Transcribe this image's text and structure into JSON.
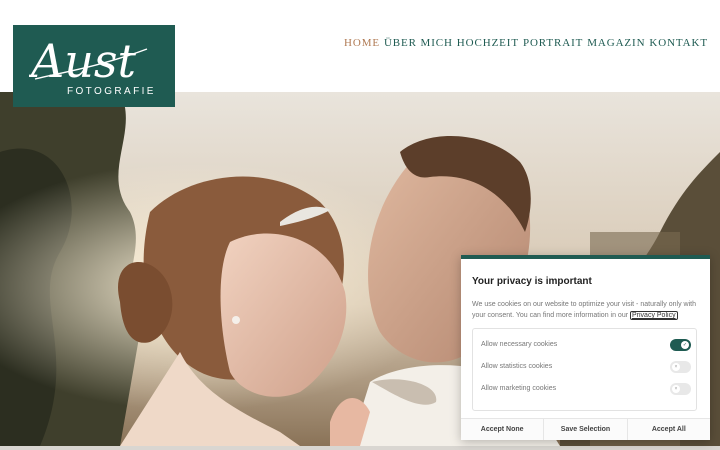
{
  "logo": {
    "script_text": "Aust",
    "subtitle": "FOTOGRAFIE"
  },
  "nav": {
    "items": [
      {
        "label": "HOME",
        "active": true
      },
      {
        "label": "ÜBER MICH",
        "active": false
      },
      {
        "label": "HOCHZEIT",
        "active": false
      },
      {
        "label": "PORTRAIT",
        "active": false
      },
      {
        "label": "MAGAZIN",
        "active": false
      },
      {
        "label": "KONTAKT",
        "active": false
      }
    ]
  },
  "colors": {
    "brand_green": "#1f5b52",
    "nav_active": "#b07a53"
  },
  "cookie": {
    "title": "Your privacy is important",
    "text": "We use cookies on our website to optimize your visit - naturally only with your consent. You can find more information in our",
    "link_text": "Privacy Policy",
    "options": [
      {
        "label": "Allow necessary cookies",
        "enabled": true
      },
      {
        "label": "Allow statistics cookies",
        "enabled": false
      },
      {
        "label": "Allow marketing cookies",
        "enabled": false
      }
    ],
    "buttons": {
      "accept_none": "Accept None",
      "save_selection": "Save Selection",
      "accept_all": "Accept All"
    }
  }
}
